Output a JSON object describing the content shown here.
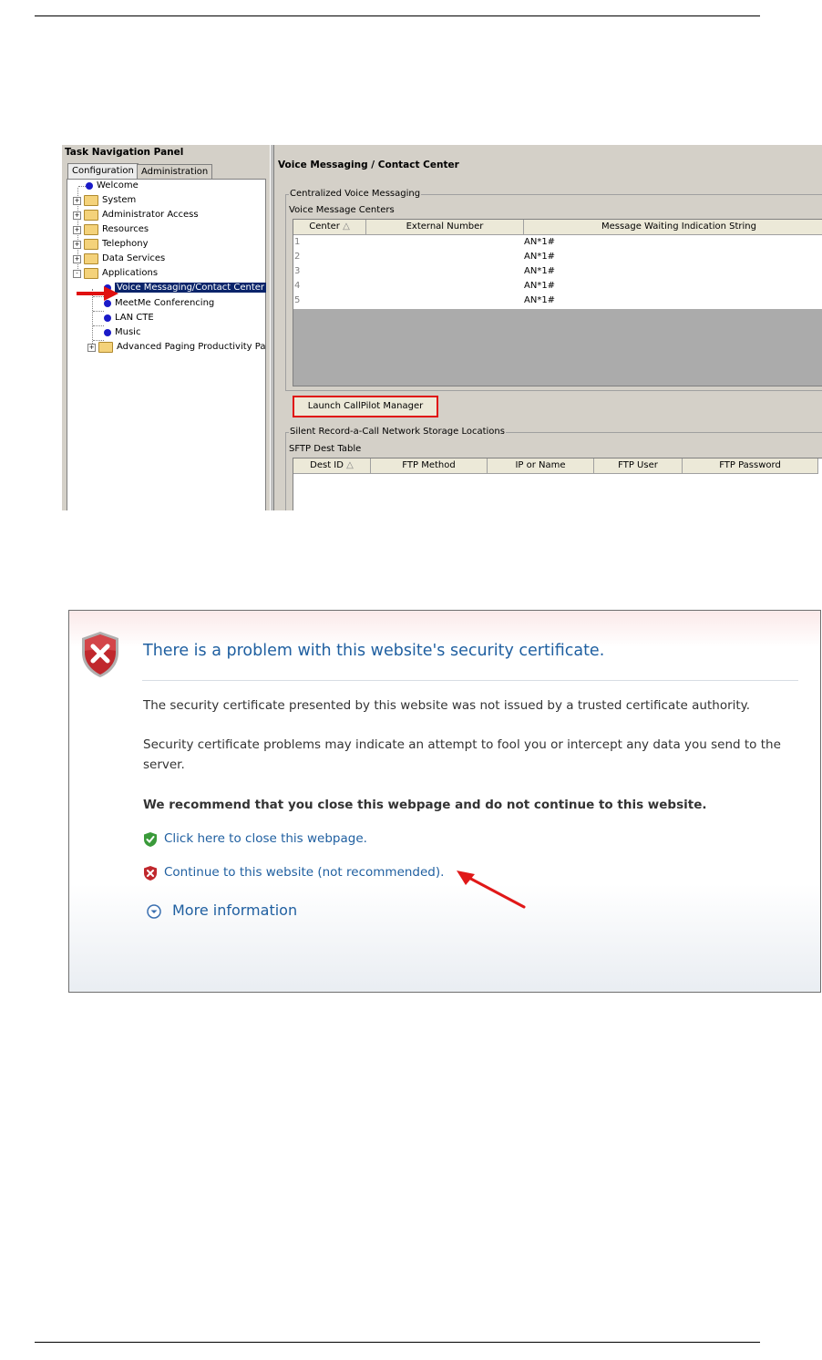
{
  "nav": {
    "title": "Task Navigation Panel",
    "tabs": [
      "Configuration",
      "Administration"
    ],
    "tree": [
      {
        "label": "Welcome",
        "icon": "blue-dot-icon"
      },
      {
        "label": "System",
        "icon": "folder-icon",
        "expander": "+"
      },
      {
        "label": "Administrator Access",
        "icon": "folder-icon",
        "expander": "+"
      },
      {
        "label": "Resources",
        "icon": "folder-icon",
        "expander": "+"
      },
      {
        "label": "Telephony",
        "icon": "folder-icon",
        "expander": "+"
      },
      {
        "label": "Data Services",
        "icon": "folder-icon",
        "expander": "+"
      },
      {
        "label": "Applications",
        "icon": "folder-icon",
        "expander": "-"
      },
      {
        "label": "Voice Messaging/Contact Center",
        "icon": "blue-dot-icon",
        "selected": true
      },
      {
        "label": "MeetMe Conferencing",
        "icon": "blue-dot-icon"
      },
      {
        "label": "LAN CTE",
        "icon": "blue-dot-icon"
      },
      {
        "label": "Music",
        "icon": "blue-dot-icon"
      },
      {
        "label": "Advanced Paging Productivity Pa",
        "icon": "folder-icon",
        "expander": "+"
      }
    ]
  },
  "panel": {
    "title": "Voice Messaging / Contact Center",
    "cvm": {
      "group_title": "Centralized Voice Messaging",
      "table_label": "Voice Message Centers",
      "columns": [
        "Center",
        "External Number",
        "Message Waiting Indication String"
      ],
      "rows": [
        {
          "center": "1",
          "external": "",
          "mwi": "AN*1#"
        },
        {
          "center": "2",
          "external": "",
          "mwi": "AN*1#"
        },
        {
          "center": "3",
          "external": "",
          "mwi": "AN*1#"
        },
        {
          "center": "4",
          "external": "",
          "mwi": "AN*1#"
        },
        {
          "center": "5",
          "external": "",
          "mwi": "AN*1#"
        }
      ]
    },
    "launch_button": "Launch CallPilot Manager",
    "srac": {
      "group_title": "Silent Record-a-Call Network Storage Locations",
      "table_label": "SFTP Dest Table",
      "columns": [
        "Dest ID",
        "FTP Method",
        "IP or Name",
        "FTP User",
        "FTP Password"
      ]
    },
    "sort_glyph": "△"
  },
  "cert": {
    "title": "There is a problem with this website's security certificate.",
    "p1": "The security certificate presented by this website was not issued by a trusted certificate authority.",
    "p2": "Security certificate problems may indicate an attempt to fool you or intercept any data you send to the server.",
    "recommend": "We recommend that you close this webpage and do not continue to this website.",
    "close_link": "Click here to close this webpage.",
    "continue_link": "Continue to this website (not recommended).",
    "more_info": "More information",
    "colors": {
      "link": "#1f5fa0",
      "shield_red": "#c0282d",
      "shield_green": "#3a9a3a"
    }
  }
}
